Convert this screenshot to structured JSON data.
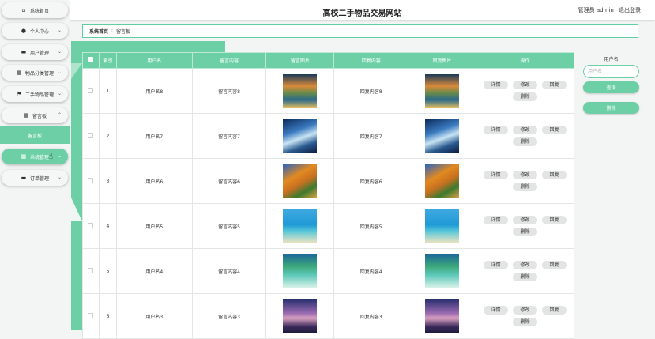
{
  "header": {
    "site_title": "高校二手物品交易网站",
    "admin_label": "管理员 admin",
    "logout_label": "退出登录"
  },
  "sidebar": {
    "items": [
      {
        "label": "系统首页",
        "icon": "home-icon",
        "glyph": "⌂"
      },
      {
        "label": "个人中心",
        "icon": "user-icon",
        "glyph": "●"
      },
      {
        "label": "用户管理",
        "icon": "users-icon",
        "glyph": "▬"
      },
      {
        "label": "物品分类管理",
        "icon": "grid-icon",
        "glyph": "▦"
      },
      {
        "label": "二手物品管理",
        "icon": "flag-icon",
        "glyph": "⚑"
      },
      {
        "label": "留言板",
        "icon": "board-icon",
        "glyph": "▦"
      },
      {
        "label": "系统管理",
        "icon": "grid-icon",
        "glyph": "▦"
      },
      {
        "label": "订单管理",
        "icon": "order-icon",
        "glyph": "▬"
      }
    ],
    "sub_active": "留言板",
    "chevron_down": "⌄",
    "chevron_up": "⌃"
  },
  "breadcrumb": {
    "home": "系统首页",
    "separator": "⁝",
    "current": "留言板"
  },
  "table": {
    "headers": [
      "",
      "索引",
      "用户名",
      "留言内容",
      "留言图片",
      "回复内容",
      "回复图片",
      "操作"
    ],
    "rows": [
      {
        "index": "1",
        "username": "用户名8",
        "content": "留言内容8",
        "reply": "回复内容8",
        "image": "lake"
      },
      {
        "index": "2",
        "username": "用户名7",
        "content": "留言内容7",
        "reply": "回复内容7",
        "image": "ice"
      },
      {
        "index": "3",
        "username": "用户名6",
        "content": "留言内容6",
        "reply": "回复内容6",
        "image": "forest"
      },
      {
        "index": "4",
        "username": "用户名5",
        "content": "留言内容5",
        "reply": "回复内容5",
        "image": "beach"
      },
      {
        "index": "5",
        "username": "用户名4",
        "content": "留言内容4",
        "reply": "回复内容4",
        "image": "island"
      },
      {
        "index": "6",
        "username": "用户名3",
        "content": "留言内容3",
        "reply": "回复内容3",
        "image": "sunset"
      }
    ],
    "actions": [
      "详情",
      "修改",
      "回复",
      "删除"
    ]
  },
  "search": {
    "label": "用户名",
    "placeholder": "用户名",
    "search_label": "查询",
    "delete_label": "删除"
  },
  "colors": {
    "accent": "#6ccfa6",
    "button_gray": "#e3e4e4"
  }
}
